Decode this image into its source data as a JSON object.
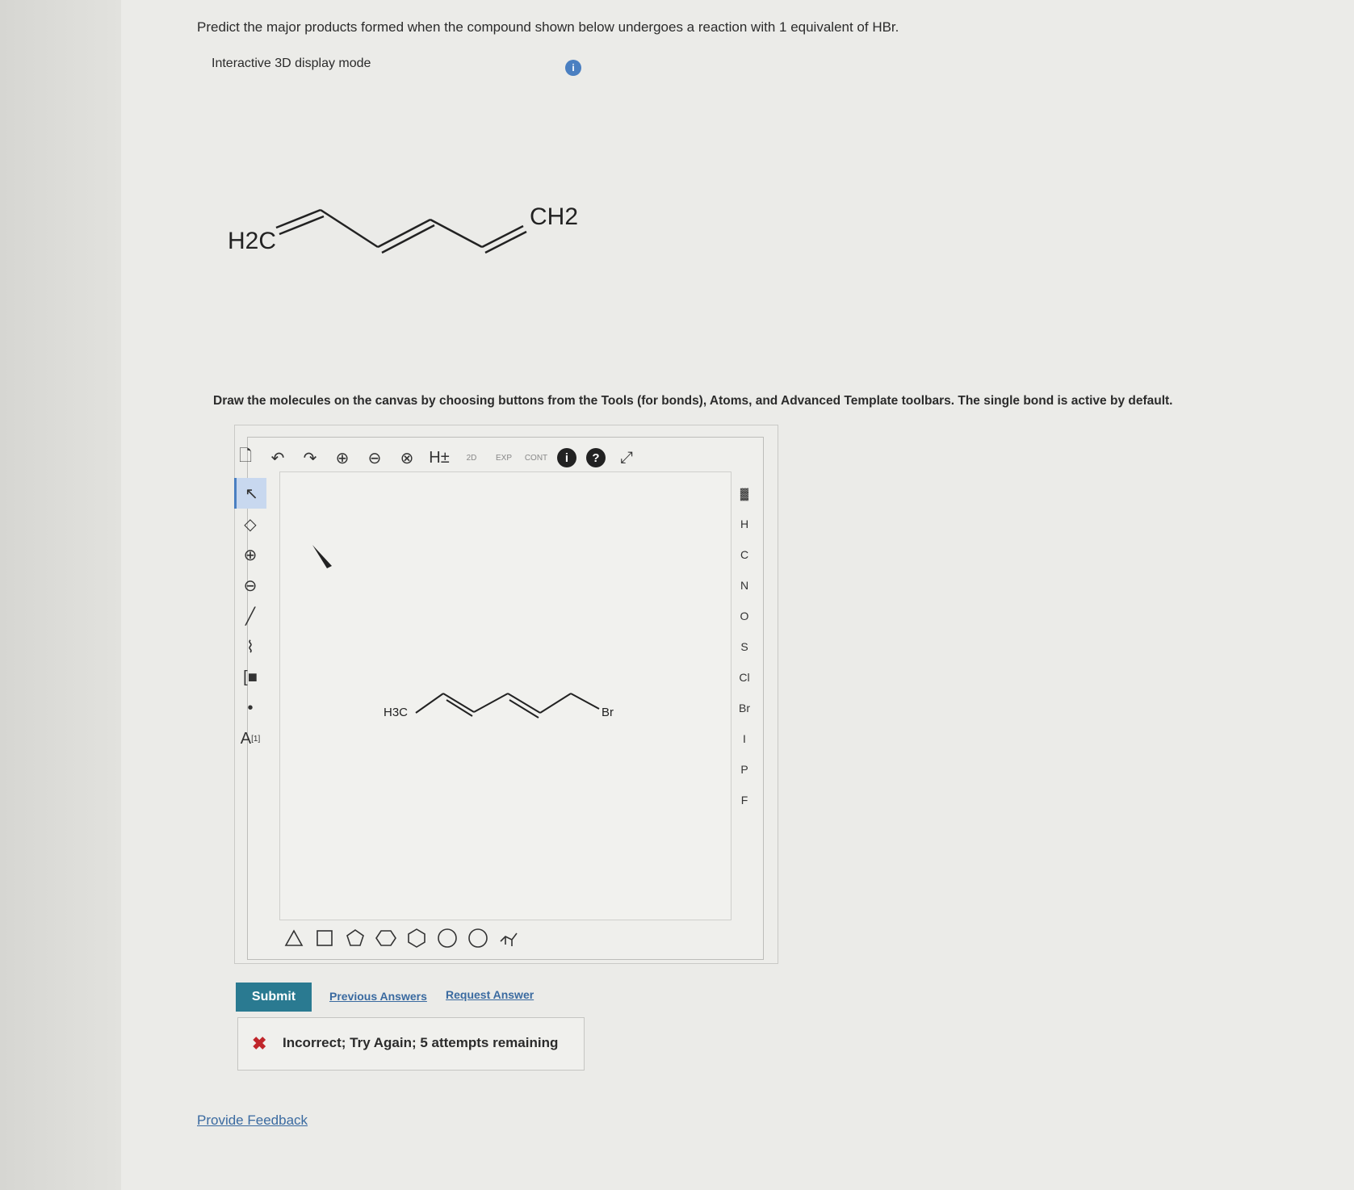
{
  "question": "Predict the major products formed when the compound shown below undergoes a reaction with 1 equivalent of HBr.",
  "display_mode": "Interactive 3D display mode",
  "info_icon": "i",
  "structure": {
    "left_label": "H2C",
    "right_label": "CH2"
  },
  "instructions": "Draw the molecules on the canvas by choosing buttons from the Tools (for bonds), Atoms, and Advanced Template toolbars. The single bond is active by default.",
  "toolbar": {
    "h_label": "H±",
    "labels_2d": "2D",
    "exp_label": "EXP",
    "cont_label": "CONT",
    "help": "?"
  },
  "left_tools": {
    "atom_props": "A",
    "atom_props_sup": "[1]"
  },
  "atoms": [
    "H",
    "C",
    "N",
    "O",
    "S",
    "Cl",
    "Br",
    "I",
    "P",
    "F"
  ],
  "canvas_molecule": {
    "left_label": "H3C",
    "right_label": "Br"
  },
  "actions": {
    "submit": "Submit",
    "previous_answers": "Previous Answers",
    "request_answer": "Request Answer"
  },
  "feedback": "Incorrect; Try Again; 5 attempts remaining",
  "provide_feedback": "Provide Feedback",
  "colors": {
    "accent": "#2a7a91",
    "error": "#c0262b",
    "link": "#3a6aa0"
  }
}
